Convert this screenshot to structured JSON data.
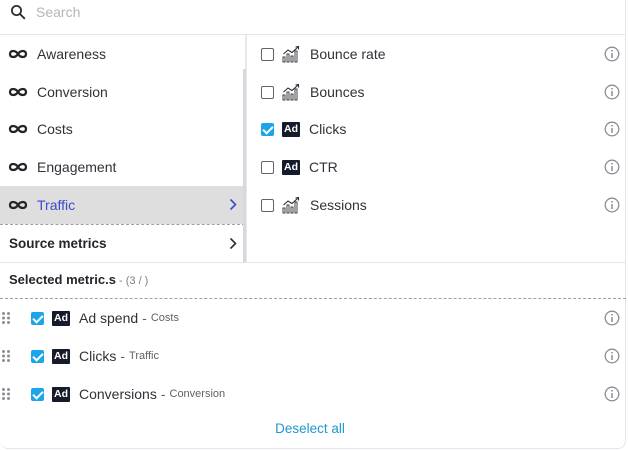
{
  "search": {
    "placeholder": "Search",
    "value": ""
  },
  "categories": [
    {
      "label": "Awareness",
      "icon": "infinity-icon"
    },
    {
      "label": "Conversion",
      "icon": "infinity-icon"
    },
    {
      "label": "Costs",
      "icon": "infinity-icon"
    },
    {
      "label": "Engagement",
      "icon": "infinity-icon"
    },
    {
      "label": "Traffic",
      "icon": "infinity-icon",
      "selected": true
    }
  ],
  "source_metrics": {
    "label": "Source metrics"
  },
  "metrics": [
    {
      "label": "Bounce rate",
      "icon": "chart-icon",
      "checked": false
    },
    {
      "label": "Bounces",
      "icon": "chart-icon",
      "checked": false
    },
    {
      "label": "Clicks",
      "icon": "ad-icon",
      "checked": true
    },
    {
      "label": "CTR",
      "icon": "ad-icon",
      "checked": false
    },
    {
      "label": "Sessions",
      "icon": "chart-icon",
      "checked": false
    }
  ],
  "ad_badge_text": "Ad",
  "selected": {
    "title": "Selected metric.s",
    "count_prefix": " - ",
    "count": "(3 / )",
    "items": [
      {
        "label": "Ad spend",
        "separator": "-",
        "category": "Costs"
      },
      {
        "label": "Clicks",
        "separator": "-",
        "category": "Traffic"
      },
      {
        "label": "Conversions",
        "separator": "-",
        "category": "Conversion"
      }
    ]
  },
  "deselect_all": "Deselect all",
  "colors": {
    "accent_blue": "#1aa6e8",
    "selected_text": "#3a4cc8",
    "link": "#1f97c9",
    "ad_badge_bg": "#151b2b",
    "selected_row_bg": "#dedede"
  }
}
